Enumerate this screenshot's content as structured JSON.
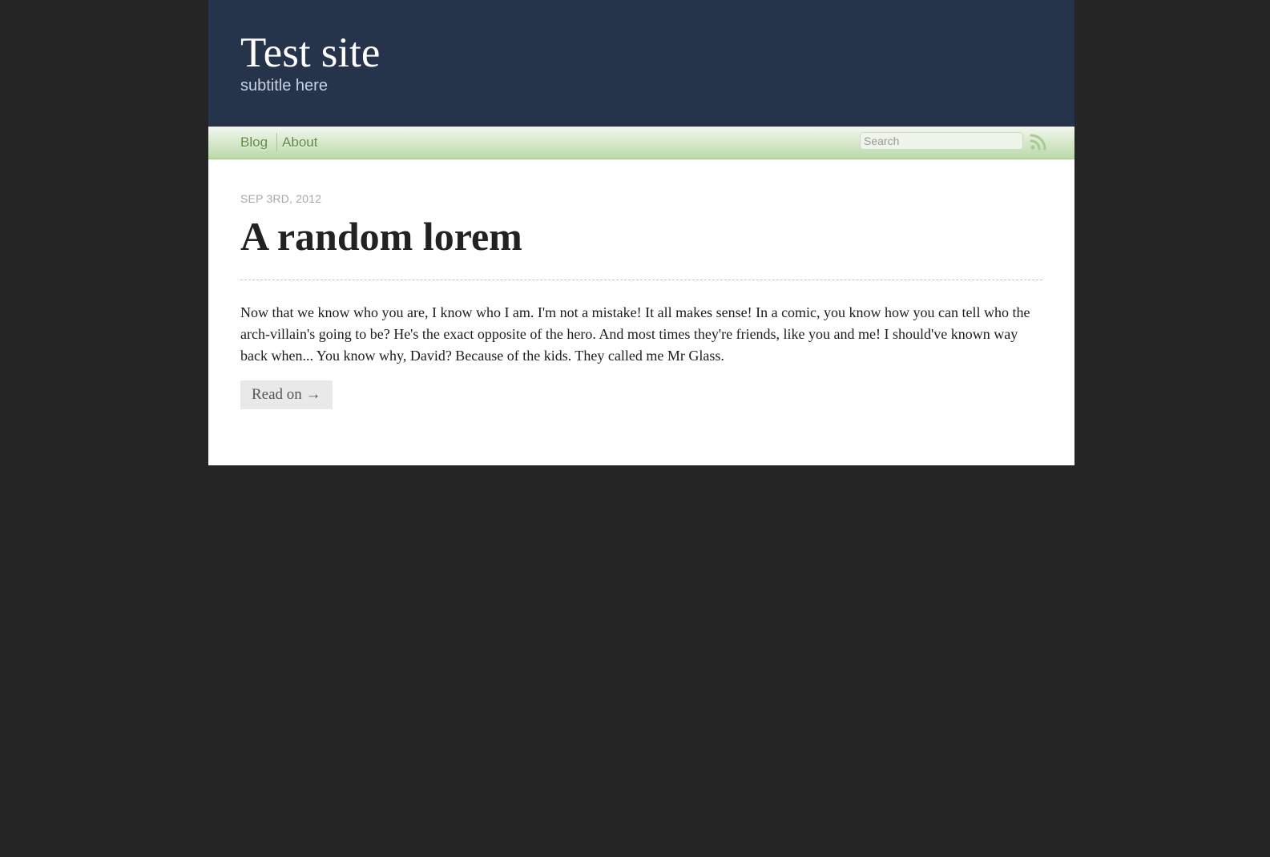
{
  "header": {
    "title": "Test site",
    "subtitle": "subtitle here"
  },
  "nav": {
    "items": [
      {
        "label": "Blog"
      },
      {
        "label": "About"
      }
    ],
    "search_placeholder": "Search",
    "rss_icon": "rss-icon"
  },
  "post": {
    "date": "SEP 3RD, 2012",
    "title": "A random lorem",
    "excerpt": "Now that we know who you are, I know who I am. I'm not a mistake! It all makes sense! In a comic, you know how you can tell who the arch-villain's going to be? He's the exact opposite of the hero. And most times they're friends, like you and me! I should've known way back when... You know why, David? Because of the kids. They called me Mr Glass.",
    "read_on_label": "Read on →"
  },
  "colors": {
    "page_background": "#252525",
    "header_background": "#26344b",
    "nav_green": "#5d8a44",
    "content_background": "#ffffff"
  }
}
